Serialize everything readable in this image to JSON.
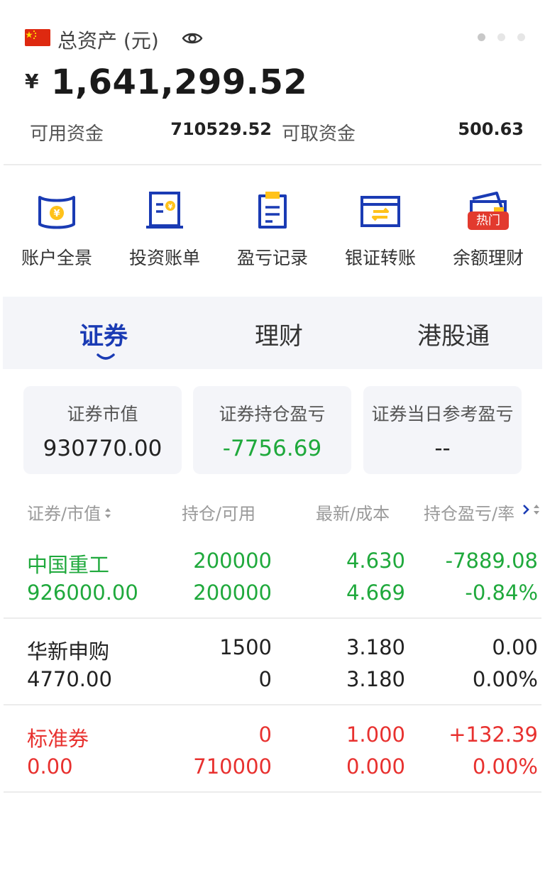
{
  "header": {
    "asset_label": "总资产 (元)",
    "currency_symbol": "¥",
    "total_assets": "1,641,299.52",
    "available_label": "可用资金",
    "available_value": "710529.52",
    "withdrawable_label": "可取资金",
    "withdrawable_value": "500.63"
  },
  "quick_actions": [
    {
      "label": "账户全景",
      "icon": "account-overview-icon"
    },
    {
      "label": "投资账单",
      "icon": "investment-bill-icon"
    },
    {
      "label": "盈亏记录",
      "icon": "profit-loss-record-icon"
    },
    {
      "label": "银证转账",
      "icon": "bank-transfer-icon"
    },
    {
      "label": "余额理财",
      "icon": "balance-wealth-icon",
      "badge": "热门"
    }
  ],
  "tabs": [
    {
      "label": "证券",
      "active": true
    },
    {
      "label": "理财",
      "active": false
    },
    {
      "label": "港股通",
      "active": false
    }
  ],
  "summary": [
    {
      "title": "证券市值",
      "value": "930770.00"
    },
    {
      "title": "证券持仓盈亏",
      "value": "-7756.69"
    },
    {
      "title": "证券当日参考盈亏",
      "value": "--"
    }
  ],
  "table": {
    "headers": [
      "证券/市值",
      "持仓/可用",
      "最新/成本",
      "持仓盈亏/率"
    ],
    "rows": [
      {
        "name": "中国重工",
        "market_value": "926000.00",
        "position": "200000",
        "available": "200000",
        "latest": "4.630",
        "cost": "4.669",
        "pnl": "-7889.08",
        "pnl_rate": "-0.84%",
        "tone": "green"
      },
      {
        "name": "华新申购",
        "market_value": "4770.00",
        "position": "1500",
        "available": "0",
        "latest": "3.180",
        "cost": "3.180",
        "pnl": "0.00",
        "pnl_rate": "0.00%",
        "tone": "dark"
      },
      {
        "name": "标准券",
        "market_value": "0.00",
        "position": "0",
        "available": "710000",
        "latest": "1.000",
        "cost": "0.000",
        "pnl": "+132.39",
        "pnl_rate": "0.00%",
        "tone": "red"
      }
    ]
  },
  "colors": {
    "accent_blue": "#1a3bb4",
    "gain_red": "#e8312f",
    "loss_green": "#1fa93c",
    "badge_red": "#e23a2e",
    "icon_yellow": "#ffc21a"
  }
}
